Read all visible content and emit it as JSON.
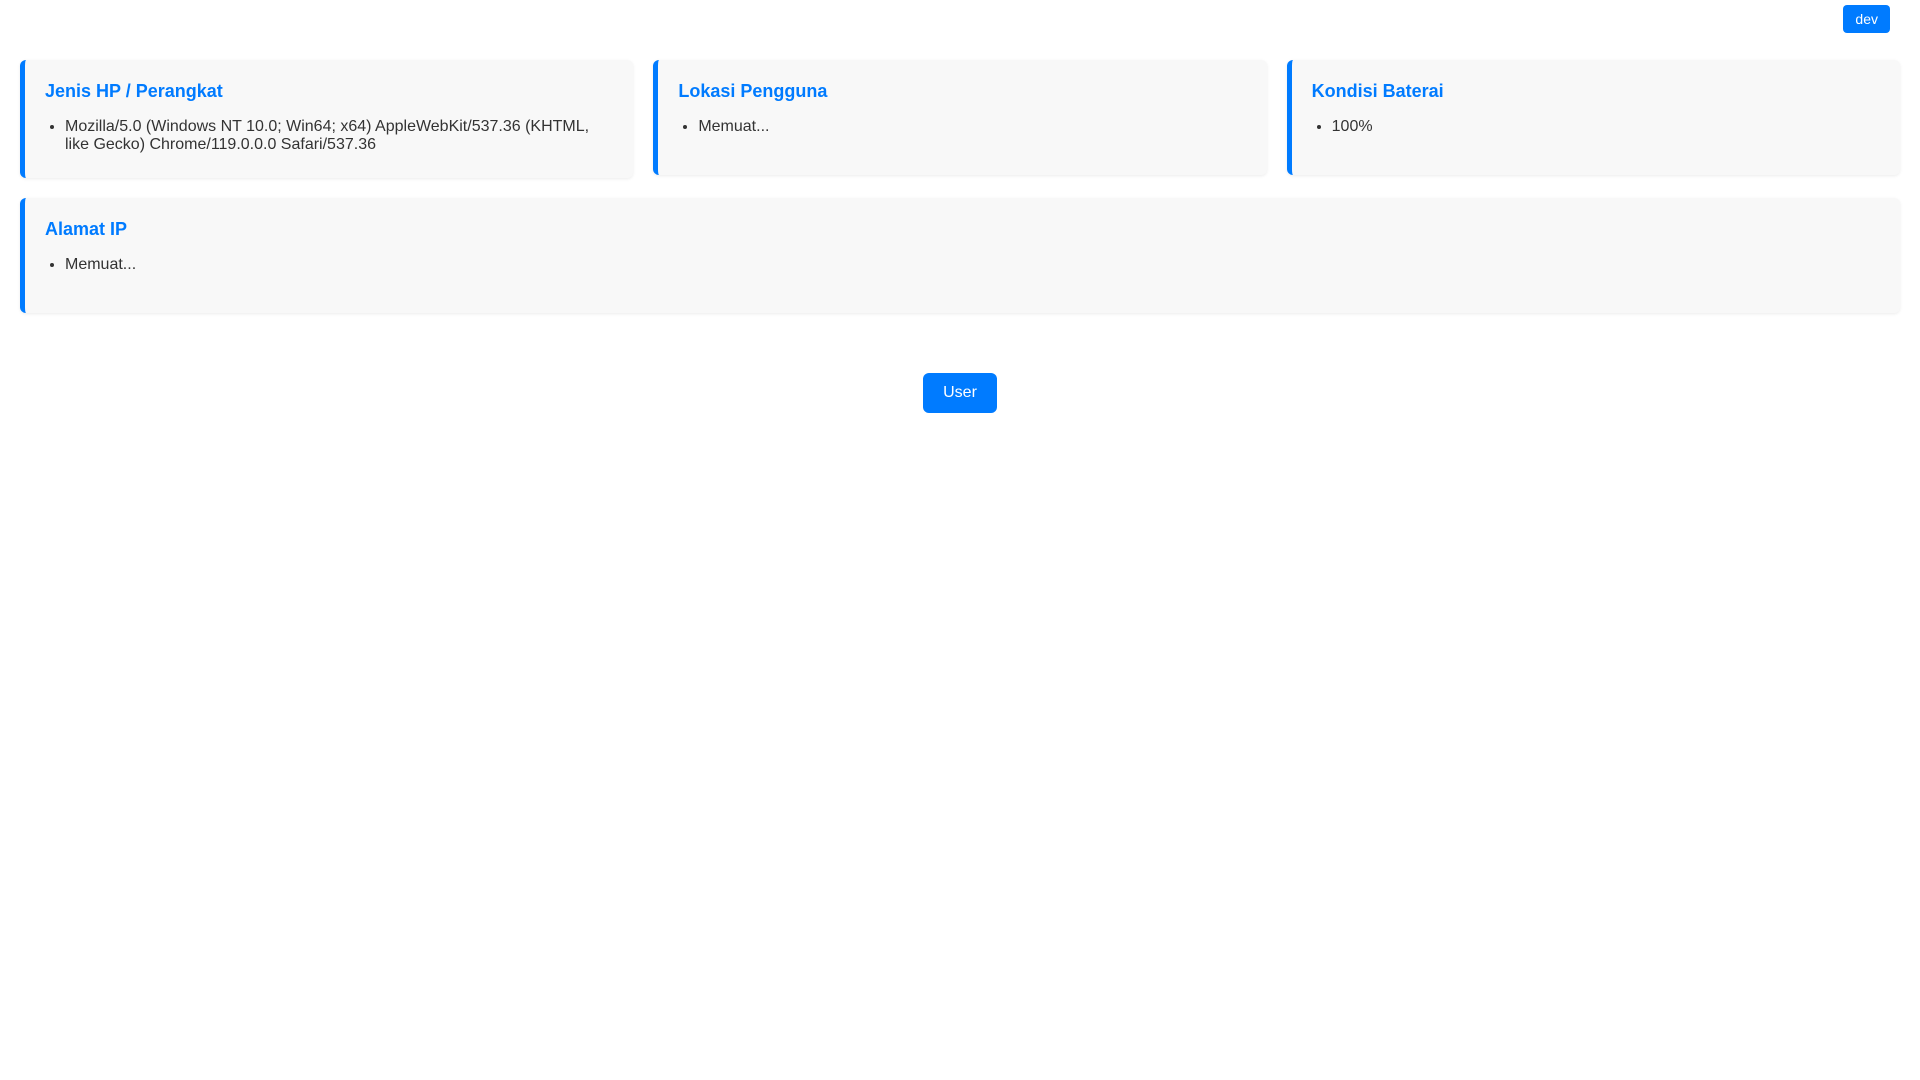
{
  "colors": {
    "accent": "#007bff",
    "card_background": "#f8f8f8",
    "text": "#333333",
    "button_text": "#ffffff"
  },
  "header": {
    "dev_label": "dev"
  },
  "cards": [
    {
      "title": "Jenis HP / Perangkat",
      "items": [
        "Mozilla/5.0 (Windows NT 10.0; Win64; x64) AppleWebKit/537.36 (KHTML, like Gecko) Chrome/119.0.0.0 Safari/537.36"
      ]
    },
    {
      "title": "Lokasi Pengguna",
      "items": [
        "Memuat..."
      ]
    },
    {
      "title": "Kondisi Baterai",
      "items": [
        "100%"
      ]
    },
    {
      "title": "Alamat IP",
      "items": [
        "Memuat..."
      ]
    }
  ],
  "footer": {
    "user_label": "User"
  }
}
